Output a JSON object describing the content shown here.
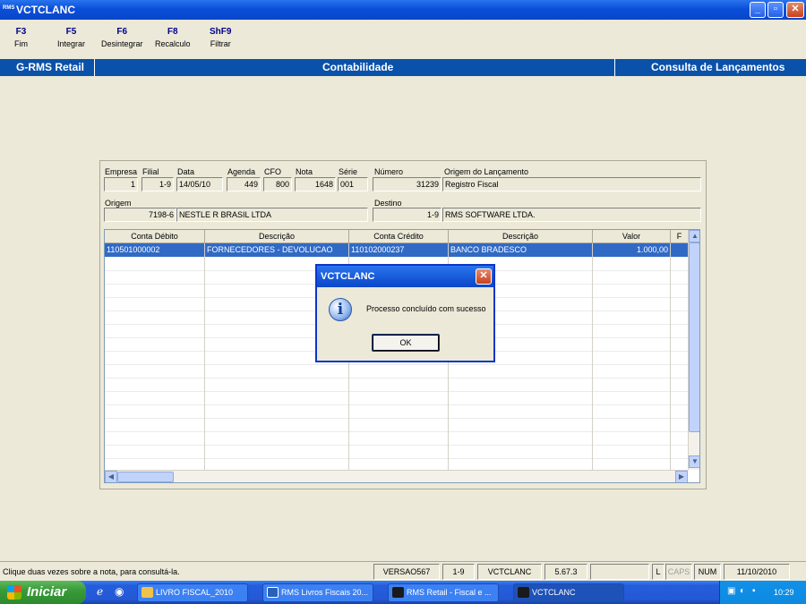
{
  "window": {
    "app_icon": "RMS",
    "title": "VCTCLANC"
  },
  "fkeys": [
    {
      "key": "F3",
      "label": "Fim"
    },
    {
      "key": "F5",
      "label": "Integrar"
    },
    {
      "key": "F6",
      "label": "Desintegrar"
    },
    {
      "key": "F8",
      "label": "Recalculo"
    },
    {
      "key": "ShF9",
      "label": "Filtrar"
    }
  ],
  "bluebar": {
    "left": "G-RMS Retail",
    "center": "Contabilidade",
    "right": "Consulta de Lançamentos"
  },
  "form": {
    "labels": {
      "empresa": "Empresa",
      "filial": "Filial",
      "data": "Data",
      "agenda": "Agenda",
      "cfo": "CFO",
      "nota": "Nota",
      "serie": "Série",
      "numero": "Número",
      "origem_lancamento": "Origem do Lançamento",
      "origem": "Origem",
      "destino": "Destino"
    },
    "values": {
      "empresa": "1",
      "filial": "1-9",
      "data": "14/05/10",
      "agenda": "449",
      "cfo": "800",
      "nota": "1648",
      "serie": "001",
      "numero": "31239",
      "origem_lancamento": "Registro Fiscal",
      "origem_codigo": "7198-6",
      "origem_nome": "NESTLE R BRASIL LTDA",
      "destino_codigo": "1-9",
      "destino_nome": "RMS SOFTWARE LTDA."
    }
  },
  "grid": {
    "columns": [
      "Conta Débito",
      "Descrição",
      "Conta Crédito",
      "Descrição",
      "Valor",
      "F"
    ],
    "rows": [
      [
        "110501000002",
        "FORNECEDORES - DEVOLUCAO",
        "110102000237",
        "BANCO BRADESCO",
        "1.000,00",
        ""
      ]
    ]
  },
  "dialog": {
    "title": "VCTCLANC",
    "message": "Processo concluído com sucesso",
    "ok_label": "OK"
  },
  "statusbar": {
    "message": "Clique duas vezes sobre a nota, para consultá-la.",
    "versao": "VERSAO567",
    "filial": "1-9",
    "programa": "VCTCLANC",
    "release": "5.67.3",
    "extra": "",
    "l": "L",
    "caps": "CAPS",
    "num": "NUM",
    "date": "11/10/2010"
  },
  "taskbar": {
    "start_label": "Iniciar",
    "items": [
      "LIVRO FISCAL_2010",
      "RMS Livros Fiscais 20...",
      "RMS Retail - Fiscal e ...",
      "VCTCLANC"
    ],
    "clock": "10:29"
  },
  "colors": {
    "accent_bar": "#0a51a9",
    "title_bar": "#0a4fd9",
    "selection": "#316ac5"
  }
}
